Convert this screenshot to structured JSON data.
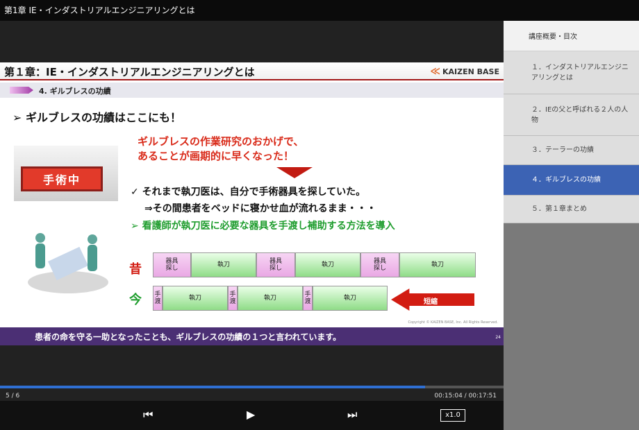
{
  "window_title": "第1章 IE・インダストリアルエンジニアリングとは",
  "sidebar": {
    "header": "講座概要・目次",
    "items": [
      {
        "label": "１．インダストリアルエンジニアリングとは",
        "active": false
      },
      {
        "label": "２．IEの父と呼ばれる２人の人物",
        "active": false
      },
      {
        "label": "３．テーラーの功績",
        "active": false
      },
      {
        "label": "４．ギルブレスの功績",
        "active": true
      },
      {
        "label": "５．第１章まとめ",
        "active": false
      }
    ]
  },
  "slide": {
    "title": "第１章：IE・インダストリアルエンジニアリングとは",
    "logo": "KAIZEN BASE",
    "subtitle": "4. ギルブレスの功績",
    "heading": "➢ ギルブレスの功績はここにも！",
    "highlight_line1": "ギルブレスの作業研究のおかげで、",
    "highlight_line2": "あることが画期的に早くなった！",
    "check_line": "✓ それまで執刀医は、自分で手術器具を探していた。",
    "arrow_line": "⇒その間患者をベッドに寝かせ血が流れるまま・・・",
    "green_line": "➢ 看護師が執刀医に必要な器具を手渡し補助する方法を導入",
    "sign_text": "手術中",
    "before_label": "昔",
    "after_label": "今",
    "before_blocks": [
      {
        "text": "器具\n探し",
        "kind": "pink"
      },
      {
        "text": "執刀",
        "kind": "green"
      },
      {
        "text": "器具\n探し",
        "kind": "pink"
      },
      {
        "text": "執刀",
        "kind": "green"
      },
      {
        "text": "器具\n探し",
        "kind": "pink"
      },
      {
        "text": "執刀",
        "kind": "green"
      }
    ],
    "after_blocks": [
      {
        "text": "手\n渡",
        "kind": "pink"
      },
      {
        "text": "執刀",
        "kind": "green"
      },
      {
        "text": "手\n渡",
        "kind": "pink"
      },
      {
        "text": "執刀",
        "kind": "green"
      },
      {
        "text": "手\n渡",
        "kind": "pink"
      },
      {
        "text": "執刀",
        "kind": "green"
      }
    ],
    "shorten_label": "短縮",
    "copyright": "Copyright © KAIZEN BASE, Inc. All Rights Reserved.",
    "footer_text": "患者の命を守る一助となったことも、ギルブレスの功績の１つと言われています。",
    "page_number": "24"
  },
  "player": {
    "counter": "5 / 6",
    "time": "00:15:04 / 00:17:51",
    "progress": 0.844,
    "prev_icon": "skip-previous-icon",
    "play_icon": "play-icon",
    "next_icon": "skip-next-icon",
    "speed": "x1.0"
  }
}
